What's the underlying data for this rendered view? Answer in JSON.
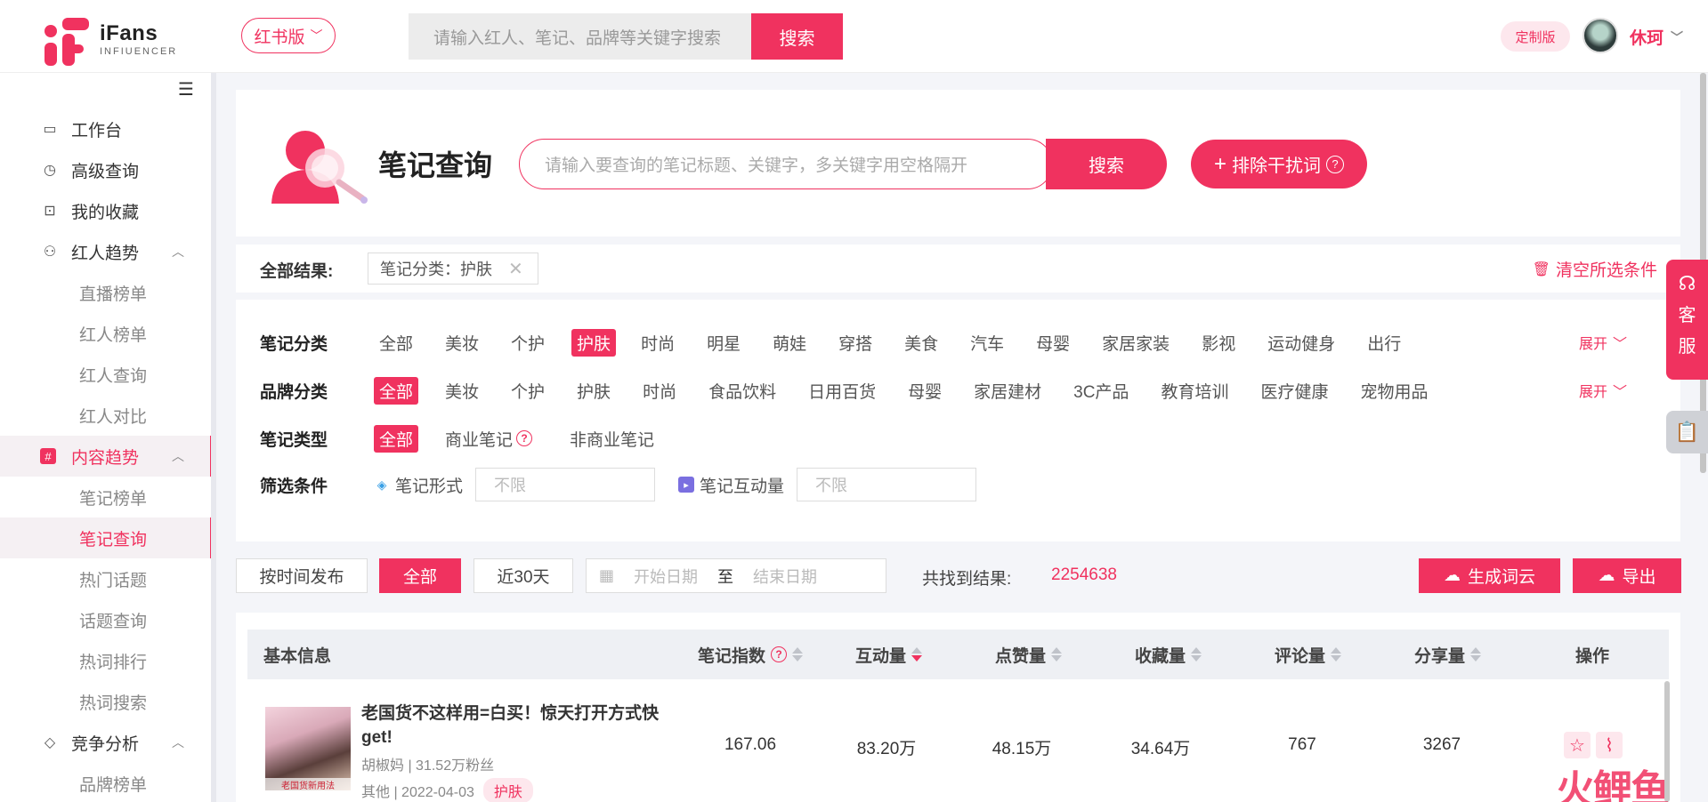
{
  "header": {
    "logo_title": "iFans",
    "logo_sub": "INFIUENCER",
    "version_label": "红书版",
    "search_placeholder": "请输入红人、笔记、品牌等关键字搜索",
    "search_btn": "搜索",
    "custom_badge": "定制版",
    "user_name": "休珂"
  },
  "sidebar": {
    "items": [
      {
        "label": "工作台",
        "icon": "monitor-icon"
      },
      {
        "label": "高级查询",
        "icon": "clock-icon"
      },
      {
        "label": "我的收藏",
        "icon": "bookmark-icon"
      },
      {
        "label": "红人趋势",
        "icon": "user-icon"
      },
      {
        "label": "直播榜单"
      },
      {
        "label": "红人榜单"
      },
      {
        "label": "红人查询"
      },
      {
        "label": "红人对比"
      },
      {
        "label": "内容趋势",
        "icon": "hash-icon"
      },
      {
        "label": "笔记榜单"
      },
      {
        "label": "笔记查询"
      },
      {
        "label": "热门话题"
      },
      {
        "label": "话题查询"
      },
      {
        "label": "热词排行"
      },
      {
        "label": "热词搜索"
      },
      {
        "label": "竞争分析",
        "icon": "diamond-icon"
      },
      {
        "label": "品牌榜单"
      }
    ]
  },
  "main": {
    "title": "笔记查询",
    "search_placeholder": "请输入要查询的笔记标题、关键字，多关键字用空格隔开",
    "search_btn": "搜索",
    "exclude_btn": "排除干扰词"
  },
  "results": {
    "label": "全部结果:",
    "chip": "笔记分类：护肤",
    "clear": "清空所选条件"
  },
  "filters": {
    "note_category": {
      "label": "笔记分类",
      "options": [
        "全部",
        "美妆",
        "个护",
        "护肤",
        "时尚",
        "明星",
        "萌娃",
        "穿搭",
        "美食",
        "汽车",
        "母婴",
        "家居家装",
        "影视",
        "运动健身",
        "出行"
      ],
      "selected": "护肤"
    },
    "brand_category": {
      "label": "品牌分类",
      "options": [
        "全部",
        "美妆",
        "个护",
        "护肤",
        "时尚",
        "食品饮料",
        "日用百货",
        "母婴",
        "家居建材",
        "3C产品",
        "教育培训",
        "医疗健康",
        "宠物用品"
      ],
      "selected": "全部"
    },
    "note_type": {
      "label": "笔记类型",
      "options": [
        "全部",
        "商业笔记",
        "非商业笔记"
      ],
      "selected": "全部"
    },
    "conditions": {
      "label": "筛选条件",
      "form_label": "笔记形式",
      "form_placeholder": "不限",
      "interact_label": "笔记互动量",
      "interact_placeholder": "不限"
    },
    "expand": "展开"
  },
  "timebar": {
    "publish_btn": "按时间发布",
    "all_btn": "全部",
    "recent_btn": "近30天",
    "start_placeholder": "开始日期",
    "to": "至",
    "end_placeholder": "结束日期",
    "found_label": "共找到结果:",
    "found_count": "2254638",
    "wordcloud_btn": "生成词云",
    "export_btn": "导出"
  },
  "table": {
    "headers": [
      "基本信息",
      "笔记指数",
      "互动量",
      "点赞量",
      "收藏量",
      "评论量",
      "分享量",
      "操作"
    ],
    "rows": [
      {
        "title": "老国货不这样用=白买！惊天打开方式快get!",
        "author": "胡椒妈 | 31.52万粉丝",
        "meta": "其他 | 2022-04-03",
        "tag": "护肤",
        "thumb_caption": "老国货新用法",
        "index": "167.06",
        "interact": "83.20万",
        "likes": "48.15万",
        "favs": "34.64万",
        "comments": "767",
        "shares": "3267"
      }
    ]
  },
  "float": {
    "service": [
      "客",
      "服"
    ]
  },
  "watermark": "火鲤鱼"
}
